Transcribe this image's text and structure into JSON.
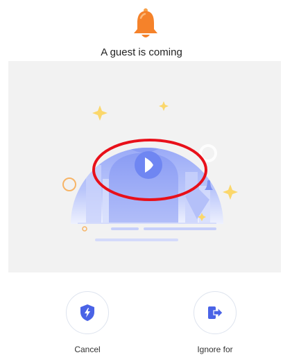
{
  "header": {
    "icon": "bell-icon",
    "icon_color": "#f5822a",
    "title": "A guest is coming"
  },
  "preview": {
    "icon": "play-icon",
    "accent_color": "#6f86f2",
    "highlight_color": "#e8101a"
  },
  "actions": [
    {
      "label": "Cancel",
      "icon": "shield-bolt-icon"
    },
    {
      "label": "Ignore for",
      "icon": "exit-arrow-icon"
    }
  ]
}
